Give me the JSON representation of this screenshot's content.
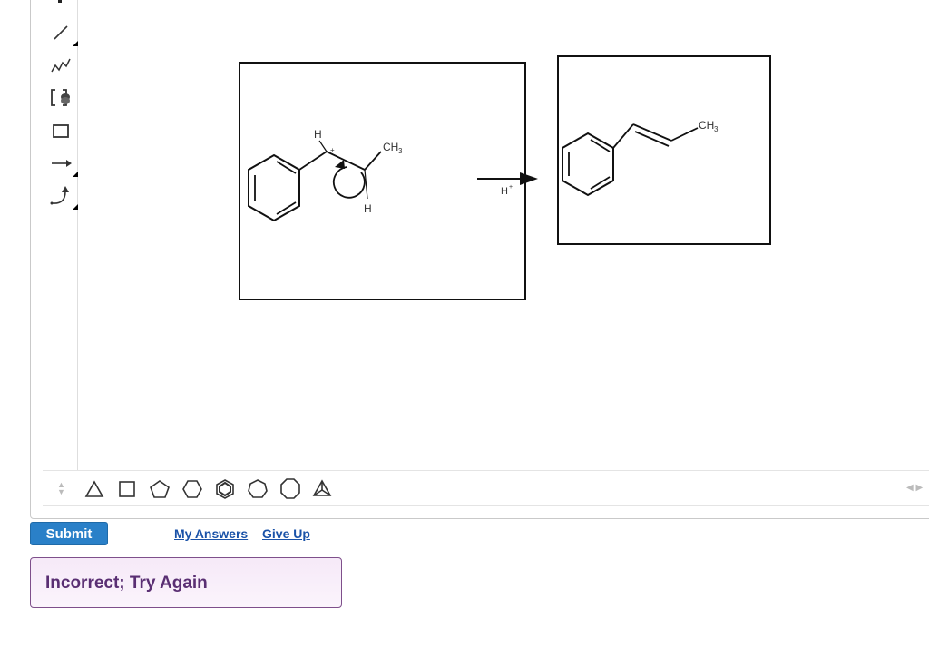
{
  "canvas": {
    "reactant": {
      "labels": {
        "h_top": "H",
        "charge": "+",
        "ch3": "CH",
        "ch3_sub": "3",
        "h_bottom": "H"
      }
    },
    "arrow": {
      "reagent": "H",
      "reagent_sup": "+"
    },
    "product": {
      "labels": {
        "ch3": "CH",
        "ch3_sub": "3"
      }
    }
  },
  "left_toolbar": {
    "tools": [
      "single-bond-tool",
      "chain-tool",
      "bracket-tool",
      "rectangle-tool",
      "reaction-arrow-tool",
      "curved-arrow-tool"
    ]
  },
  "bottom_toolbar": {
    "shapes": [
      "triangle",
      "square",
      "pentagon",
      "hexagon",
      "benzene",
      "heptagon",
      "octagon",
      "bicyclic"
    ]
  },
  "actions": {
    "submit_label": "Submit",
    "my_answers_label": "My Answers",
    "give_up_label": "Give Up"
  },
  "feedback": {
    "message": "Incorrect; Try Again"
  }
}
